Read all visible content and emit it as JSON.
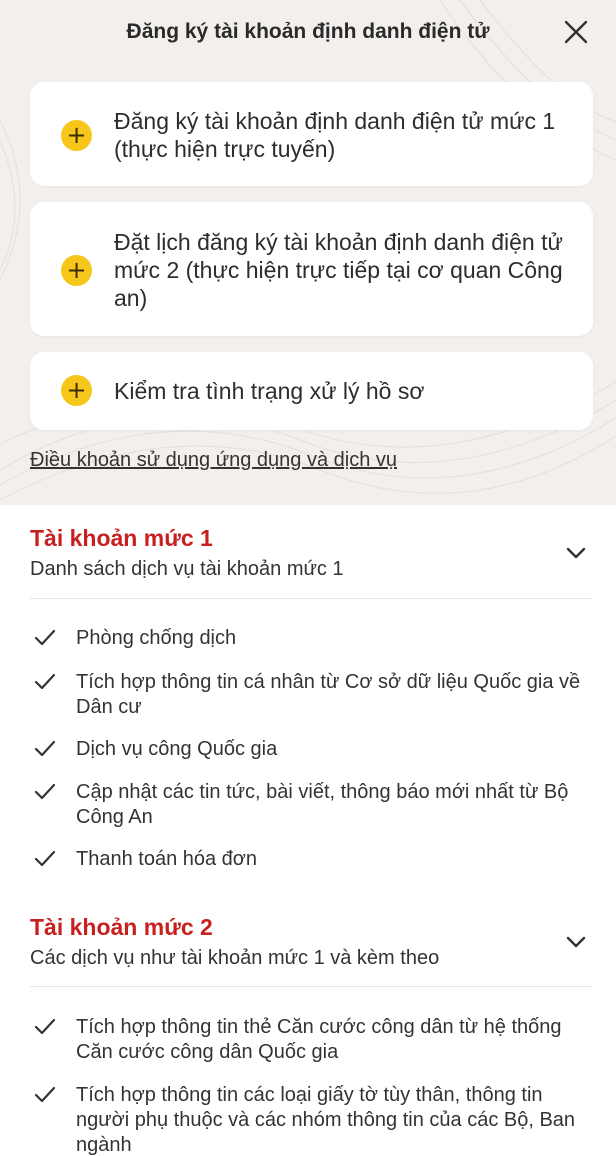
{
  "header": {
    "title": "Đăng ký tài khoản định danh điện tử",
    "close_icon": "close-icon"
  },
  "cards": [
    {
      "label": "Đăng ký tài khoản định danh điện tử mức 1 (thực hiện trực tuyến)",
      "icon": "plus-icon"
    },
    {
      "label": "Đặt lịch đăng ký tài khoản định danh điện tử mức 2 (thực hiện trực tiếp tại cơ quan Công an)",
      "icon": "plus-icon"
    },
    {
      "label": "Kiểm tra tình trạng xử lý hồ sơ",
      "icon": "plus-icon"
    }
  ],
  "terms_link": "Điều khoản sử dụng ứng dụng và dịch vụ",
  "level1": {
    "title": "Tài khoản mức 1",
    "subtitle": "Danh sách dịch vụ tài khoản mức 1",
    "items": [
      "Phòng chống dịch",
      "Tích hợp thông tin cá nhân từ Cơ sở dữ liệu Quốc gia về Dân cư",
      "Dịch vụ công Quốc gia",
      "Cập nhật các tin tức, bài viết, thông báo mới nhất từ Bộ Công An",
      "Thanh toán hóa đơn"
    ]
  },
  "level2": {
    "title": "Tài khoản mức 2",
    "subtitle": "Các dịch vụ như tài khoản mức 1 và kèm theo",
    "items": [
      "Tích hợp thông tin thẻ Căn cước công dân từ hệ thống Căn cước công dân Quốc gia",
      "Tích hợp thông tin các loại giấy tờ tùy thân, thông tin người phụ thuộc và các nhóm thông tin của các Bộ, Ban ngành"
    ]
  },
  "colors": {
    "accent_red": "#c8201f",
    "plus_yellow": "#f7c61a",
    "top_background": "#f2efec"
  }
}
